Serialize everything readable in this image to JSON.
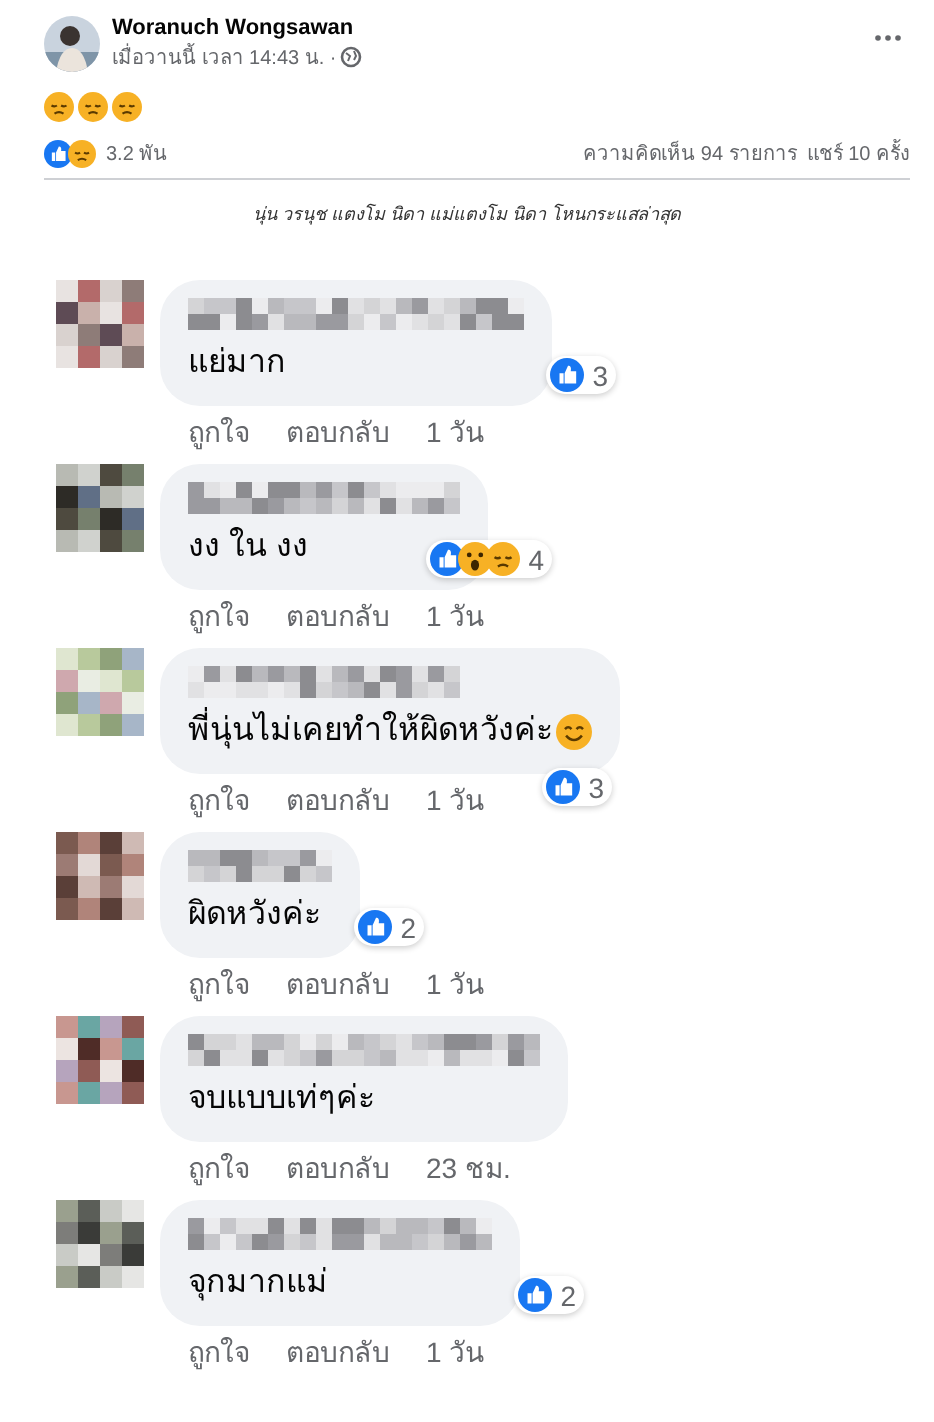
{
  "post": {
    "author": "Woranuch Wongsawan",
    "meta": "เมื่อวานนี้ เวลา 14:43 น. ·",
    "emojis": [
      {
        "kind": "sad"
      },
      {
        "kind": "sad"
      },
      {
        "kind": "sad"
      }
    ],
    "reactions": [
      {
        "kind": "like"
      },
      {
        "kind": "sad"
      }
    ],
    "reaction_count": "3.2 พัน",
    "comments_count": "ความคิดเห็น 94 รายการ",
    "shares": "แชร์ 10 ครั้ง"
  },
  "caption": "นุ่น วรนุช แตงโม นิดา แม่แตงโม นิดา โหนกระแสล่าสุด",
  "comments": [
    {
      "text": "แย่มาก",
      "reactions": [
        {
          "kind": "like"
        }
      ],
      "count": "3",
      "actions": [
        "ถูกใจ",
        "ตอบกลับ"
      ],
      "time": "1 วัน"
    },
    {
      "text": "งง ใน งง",
      "reactions": [
        {
          "kind": "like"
        },
        {
          "kind": "wow"
        },
        {
          "kind": "sad"
        }
      ],
      "count": "4",
      "actions": [
        "ถูกใจ",
        "ตอบกลับ"
      ],
      "time": "1 วัน"
    },
    {
      "text": "พี่นุ่นไม่เคยทำให้ผิดหวังค่ะ",
      "trailing_emoji": {
        "kind": "smile"
      },
      "reactions": [
        {
          "kind": "like"
        }
      ],
      "count": "3",
      "badge_below": true,
      "actions": [
        "ถูกใจ",
        "ตอบกลับ"
      ],
      "time": "1 วัน"
    },
    {
      "text": "ผิดหวังค่ะ",
      "reactions": [
        {
          "kind": "like"
        }
      ],
      "count": "2",
      "actions": [
        "ถูกใจ",
        "ตอบกลับ"
      ],
      "time": "1 วัน"
    },
    {
      "text": "จบแบบเท่ๆค่ะ",
      "actions": [
        "ถูกใจ",
        "ตอบกลับ"
      ],
      "time": "23 ชม."
    },
    {
      "text": "จุกมากแม่",
      "reactions": [
        {
          "kind": "like"
        }
      ],
      "count": "2",
      "actions": [
        "ถูกใจ",
        "ตอบกลับ"
      ],
      "time": "1 วัน"
    }
  ]
}
